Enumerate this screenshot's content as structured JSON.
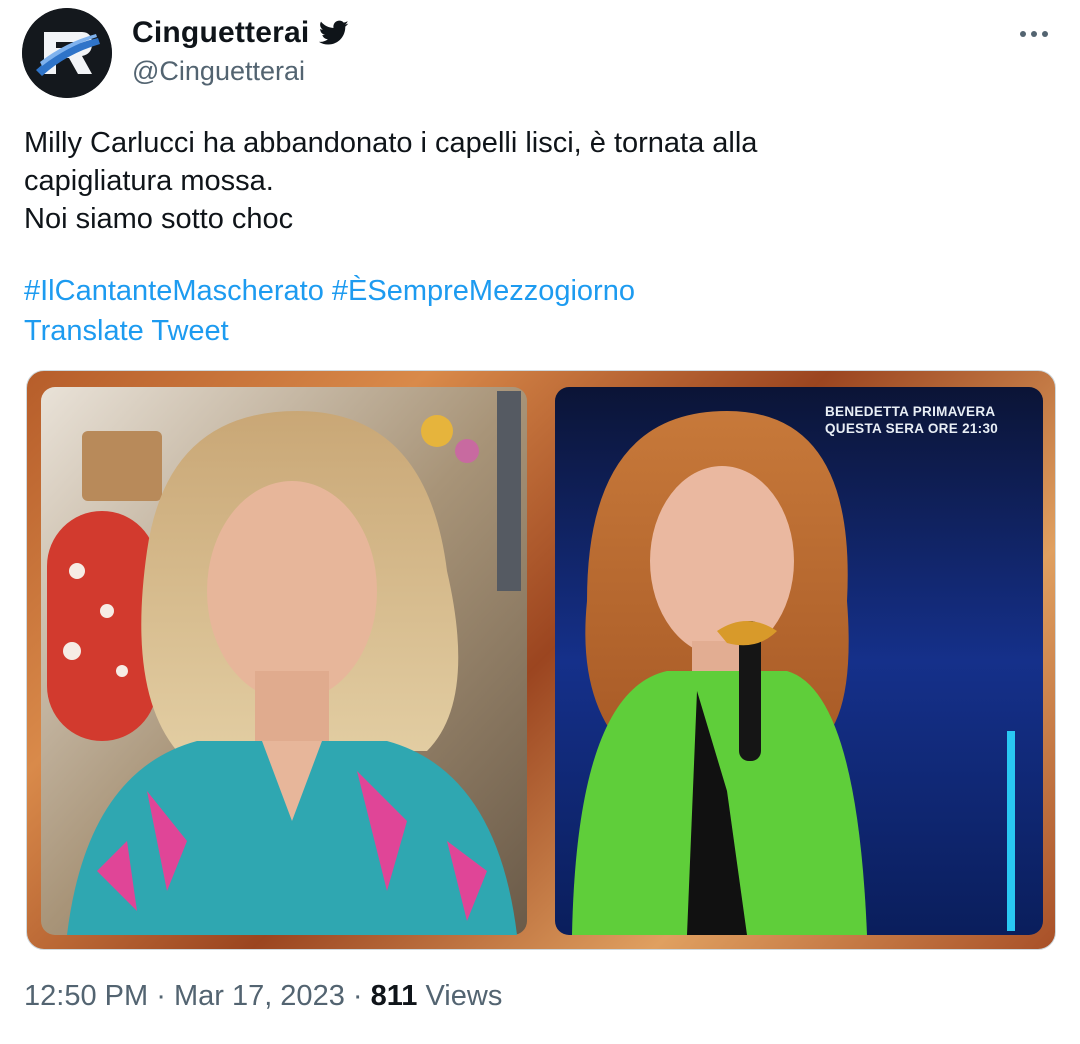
{
  "tweet": {
    "author": {
      "display_name": "Cinguetterai",
      "handle": "@Cinguetterai",
      "verified_icon": "twitter-bird-icon"
    },
    "more_icon": "more-horizontal-icon",
    "text_lines": [
      "Milly Carlucci ha abbandonato i capelli lisci, è tornata alla",
      "capigliatura mossa.",
      "Noi siamo sotto choc"
    ],
    "hashtags": [
      "#IlCantanteMascherato",
      "#ÈSempreMezzogiorno"
    ],
    "translate_label": "Translate Tweet",
    "media": {
      "overlay_line1": "BENEDETTA PRIMAVERA",
      "overlay_line2": "QUESTA SERA ORE 21:30"
    },
    "meta": {
      "time": "12:50 PM",
      "separator": "·",
      "date": "Mar 17, 2023",
      "views_count": "811",
      "views_label": "Views"
    }
  },
  "colors": {
    "link": "#1d9bf0",
    "secondary_text": "#536471",
    "primary_text": "#0f1419"
  }
}
